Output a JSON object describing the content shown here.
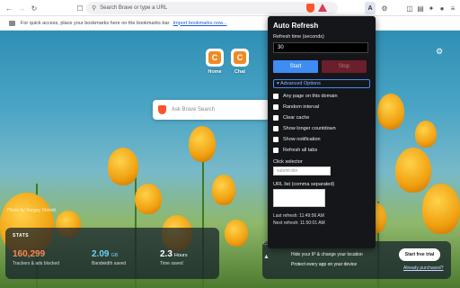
{
  "toolbar": {
    "back_icon": "back-arrow-icon",
    "forward_icon": "forward-arrow-icon",
    "reload_icon": "reload-icon",
    "bookmark_icon": "bookmark-icon",
    "url_placeholder": "Search Brave or type a URL",
    "extension_label": "A"
  },
  "bookmarks": {
    "message": "For quick access, place your bookmarks here on the bookmarks bar.",
    "link": "Import bookmarks now..."
  },
  "top_sites": [
    {
      "letter": "C",
      "label": "Home"
    },
    {
      "letter": "C",
      "label": "Chat"
    }
  ],
  "search": {
    "placeholder": "Ask Brave Search"
  },
  "photo_credit": "Photo by Sergey Shmidt",
  "stats": {
    "title": "STATS",
    "items": [
      {
        "value": "160,299",
        "unit": "",
        "caption": "Trackers & ads blocked",
        "color": "#f08a5d"
      },
      {
        "value": "2.09",
        "unit": "GB",
        "caption": "Bandwidth saved",
        "color": "#6fd0f0"
      },
      {
        "value": "2.3",
        "unit": "Hours",
        "caption": "Time saved",
        "color": "#ffffff"
      }
    ]
  },
  "vpn": {
    "line1": "Hide your IP & change your location",
    "line2": "Protect every app on your device",
    "trial_label": "Start free trial",
    "bought_label": "Already purchased?"
  },
  "popup": {
    "title": "Auto Refresh",
    "refresh_label": "Refresh time (seconds)",
    "refresh_value": "30",
    "start_label": "Start",
    "stop_label": "Stop",
    "advanced_label": "▾ Advanced Options",
    "options": [
      "Any page on this domain",
      "Random interval",
      "Clear cache",
      "Show longer countdown",
      "Show notification",
      "Refresh all tabs"
    ],
    "click_selector_label": "Click selector",
    "click_selector_placeholder": "submit-btn",
    "url_list_label": "URL list (comma separated)",
    "last_refresh": "Last refresh: 11:49:56 AM",
    "next_refresh": "Next refresh: 11:50:01 AM"
  }
}
